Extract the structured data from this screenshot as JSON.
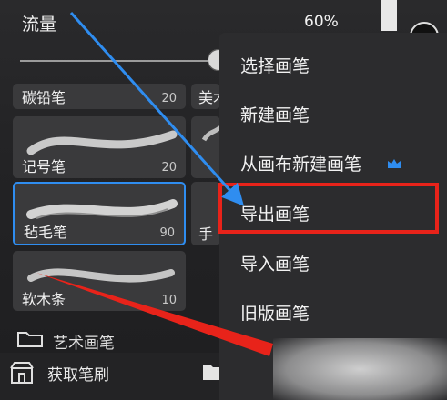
{
  "header": {
    "flow_label": "流量",
    "flow_value": "60%",
    "flow_level_percent": 60
  },
  "brushes": [
    {
      "name": "碳铅笔",
      "size": "20"
    },
    {
      "name": "美术",
      "size": ""
    },
    {
      "name": "记号笔",
      "size": "20"
    },
    {
      "name": "毡毛笔",
      "size": "90",
      "selected": true
    },
    {
      "name": "手",
      "size": ""
    },
    {
      "name": "软木条",
      "size": "10"
    }
  ],
  "folder": {
    "label": "艺术画笔"
  },
  "bottom_bar": {
    "get_brushes_label": "获取笔刷"
  },
  "menu": {
    "items": [
      {
        "label": "选择画笔"
      },
      {
        "label": "新建画笔"
      },
      {
        "label": "从画布新建画笔",
        "badge_icon": "crown-icon"
      },
      {
        "label": "导出画笔",
        "highlighted": true
      },
      {
        "label": "导入画笔"
      },
      {
        "label": "旧版画笔"
      }
    ]
  },
  "colors": {
    "selection_border": "#2f8df0",
    "highlight_red": "#e8231a",
    "arrow_blue": "#2f8df0",
    "crown_blue": "#2f8df0",
    "menu_bg": "#2c2c2e"
  }
}
